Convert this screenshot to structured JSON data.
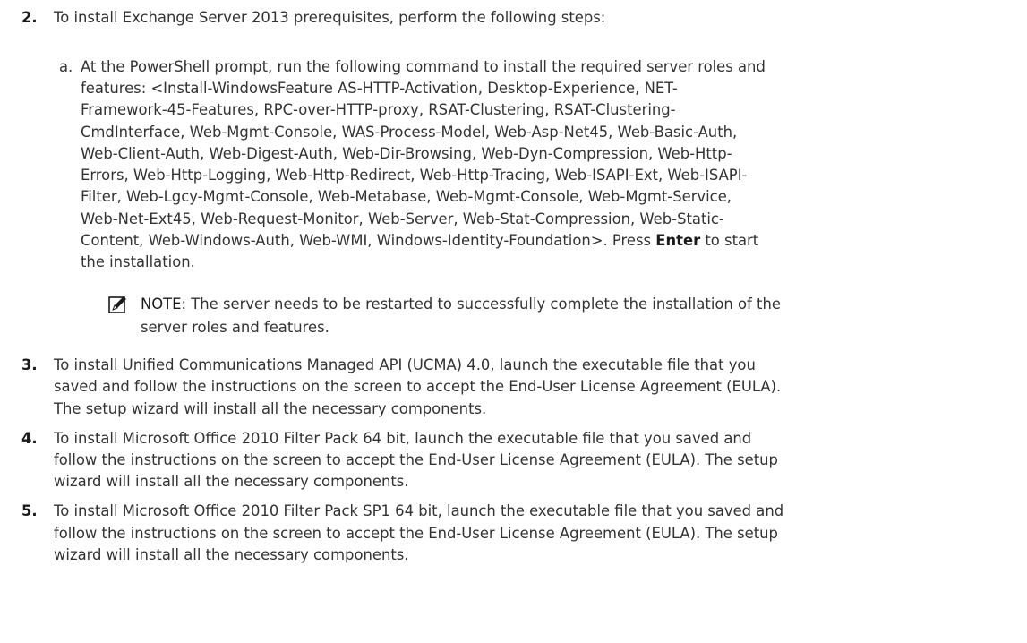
{
  "steps": [
    {
      "number": "2.",
      "text": "To install Exchange Server 2013 prerequisites, perform the following steps:"
    },
    {
      "number": "3.",
      "lines": [
        "To install Unified Communications Managed API (UCMA) 4.0, launch the executable file that you",
        "saved and follow the instructions on the screen to accept the End-User License Agreement (EULA).",
        "The setup wizard will install all the necessary components."
      ]
    },
    {
      "number": "4.",
      "lines": [
        "To install Microsoft Office 2010 Filter Pack 64 bit, launch the executable file that you saved and",
        "follow the instructions on the screen to accept the End-User License Agreement (EULA). The setup",
        "wizard will install all the necessary components."
      ]
    },
    {
      "number": "5.",
      "lines": [
        "To install Microsoft Office 2010 Filter Pack SP1 64 bit, launch the executable file that you saved and",
        "follow the instructions on the screen to accept the End-User License Agreement (EULA). The setup",
        "wizard will install all the necessary components."
      ]
    }
  ],
  "substep": {
    "letter": "a.",
    "lines": [
      "At the PowerShell prompt, run the following command to install the required server roles and",
      "features: <Install-WindowsFeature AS-HTTP-Activation, Desktop-Experience, NET-",
      "Framework-45-Features, RPC-over-HTTP-proxy, RSAT-Clustering, RSAT-Clustering-",
      "CmdInterface, Web-Mgmt-Console, WAS-Process-Model, Web-Asp-Net45, Web-Basic-Auth,",
      "Web-Client-Auth, Web-Digest-Auth, Web-Dir-Browsing, Web-Dyn-Compression, Web-Http-",
      "Errors, Web-Http-Logging, Web-Http-Redirect, Web-Http-Tracing, Web-ISAPI-Ext, Web-ISAPI-",
      "Filter, Web-Lgcy-Mgmt-Console, Web-Metabase, Web-Mgmt-Console, Web-Mgmt-Service,",
      "Web-Net-Ext45, Web-Request-Monitor, Web-Server, Web-Stat-Compression, Web-Static-",
      "Content, Web-Windows-Auth, Web-WMI, Windows-Identity-Foundation>. Press "
    ],
    "press_key": "Enter",
    "line9_tail": " to start",
    "last_line": "the installation."
  },
  "note": {
    "icon": "pencil-note-icon",
    "label": "NOTE:",
    "line1": " The server needs to be restarted to successfully complete the installation of the",
    "line2": "server roles and features."
  }
}
